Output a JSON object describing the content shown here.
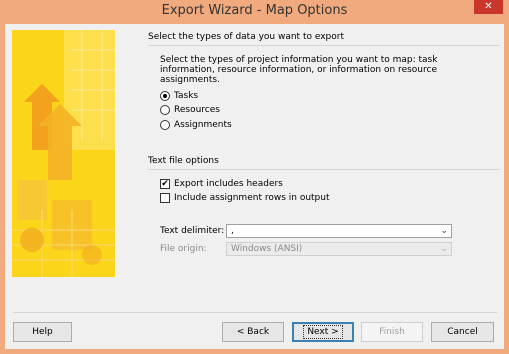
{
  "window": {
    "title": "Export Wizard - Map Options",
    "close_glyph": "✕"
  },
  "export_types": {
    "heading": "Select the types of data you want to export",
    "description": "Select the types of project information you want to map: task information, resource information, or information on resource assignments.",
    "options": [
      {
        "label": "Tasks",
        "selected": true
      },
      {
        "label": "Resources",
        "selected": false
      },
      {
        "label": "Assignments",
        "selected": false
      }
    ]
  },
  "text_file_options": {
    "heading": "Text file options",
    "include_headers": {
      "label": "Export includes headers",
      "checked": true,
      "check_glyph": "✔"
    },
    "include_assignments": {
      "label": "Include assignment rows in output",
      "checked": false
    },
    "text_delimiter": {
      "label": "Text delimiter:",
      "value": ","
    },
    "file_origin": {
      "label": "File origin:",
      "value": "Windows (ANSI)"
    },
    "dropdown_glyph": "⌄"
  },
  "buttons": {
    "help": "Help",
    "back": "< Back",
    "next": "Next >",
    "finish": "Finish",
    "cancel": "Cancel"
  },
  "colors": {
    "title_bar": "#f1aa7e",
    "close": "#c9372c",
    "art_yellow": "#fbd51a"
  }
}
